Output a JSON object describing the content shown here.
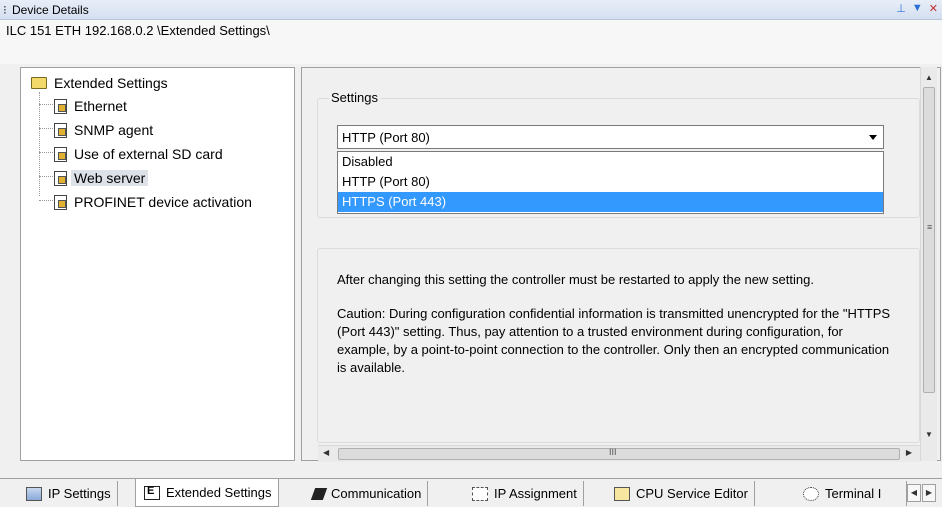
{
  "window": {
    "title": "Device Details",
    "path": "ILC 151 ETH 192.168.0.2 \\Extended Settings\\"
  },
  "tree": {
    "root": "Extended Settings",
    "items": [
      {
        "label": "Ethernet"
      },
      {
        "label": "SNMP agent"
      },
      {
        "label": "Use of external SD card"
      },
      {
        "label": "Web server",
        "selected": true
      },
      {
        "label": "PROFINET device activation"
      }
    ]
  },
  "settings": {
    "group_label": "Settings",
    "selected_value": "HTTP (Port 80)",
    "options": [
      "Disabled",
      "HTTP (Port 80)",
      "HTTPS (Port 443)"
    ],
    "highlighted_option": "HTTPS (Port 443)"
  },
  "info": {
    "paragraph1": "After changing this setting the controller must be restarted to apply the new setting.",
    "paragraph2": "Caution: During configuration confidential information is transmitted unencrypted for the \"HTTPS (Port 443)\" setting. Thus, pay attention to a trusted environment during configuration, for example, by a point-to-point connection to the controller. Only then an encrypted communication is available."
  },
  "tabs": [
    {
      "label": "IP Settings",
      "icon": "network-icon"
    },
    {
      "label": "Extended Settings",
      "icon": "extended-settings-icon",
      "active": true
    },
    {
      "label": "Communication",
      "icon": "communication-icon"
    },
    {
      "label": "IP Assignment",
      "icon": "ip-assignment-icon"
    },
    {
      "label": "CPU Service Editor",
      "icon": "cpu-icon"
    },
    {
      "label": "Terminal I",
      "icon": "terminal-icon"
    }
  ],
  "colors": {
    "highlight": "#3399ff",
    "title_gradient_top": "#e8eef8"
  }
}
